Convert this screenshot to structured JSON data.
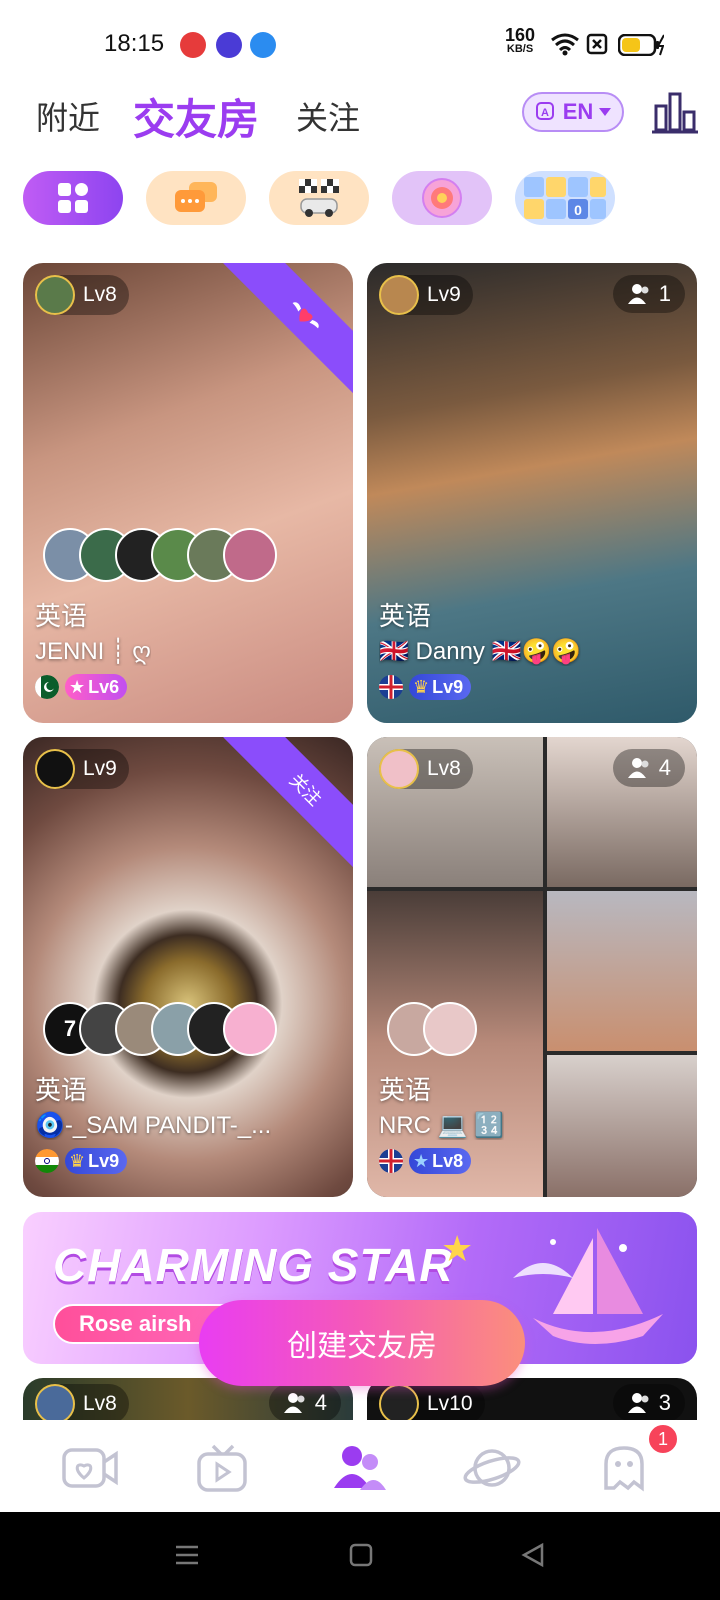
{
  "status_bar": {
    "time": "18:15",
    "net_speed": "160",
    "net_unit": "KB/S"
  },
  "header": {
    "tabs": [
      {
        "label": "附近"
      },
      {
        "label": "交友房"
      },
      {
        "label": "关注"
      }
    ],
    "language": "EN"
  },
  "categories": [
    {
      "icon": "grid-icon",
      "active": true
    },
    {
      "icon": "chat-bubbles-icon"
    },
    {
      "icon": "racing-flags-icon"
    },
    {
      "icon": "wheel-icon"
    },
    {
      "icon": "number-puzzle-icon"
    }
  ],
  "rooms": [
    {
      "level": "Lv8",
      "ribbon": "heart",
      "language": "英语",
      "host": "JENNI ┊ ღ",
      "host_level": "Lv6",
      "flag": "PK",
      "member_count": null
    },
    {
      "level": "Lv9",
      "language": "英语",
      "host": "🇬🇧 Danny 🇬🇧🤪🤪",
      "host_level": "Lv9",
      "flag": "GB",
      "member_count": "1"
    },
    {
      "level": "Lv9",
      "ribbon": "关注",
      "language": "英语",
      "host": "🧿-_SAM PANDIT-_...",
      "host_level": "Lv9",
      "flag": "IN",
      "extra_count": "7"
    },
    {
      "level": "Lv8",
      "language": "英语",
      "host": "NRC 💻 🔢",
      "host_level": "Lv8",
      "flag": "GB",
      "member_count": "4"
    },
    {
      "level": "Lv8",
      "member_count": "4"
    },
    {
      "level": "Lv10",
      "member_count": "3"
    }
  ],
  "banner": {
    "title": "CHARMING STAR",
    "subtitle": "Rose airsh"
  },
  "create_button": {
    "label": "创建交友房"
  },
  "bottom_nav": {
    "message_badge": "1"
  }
}
